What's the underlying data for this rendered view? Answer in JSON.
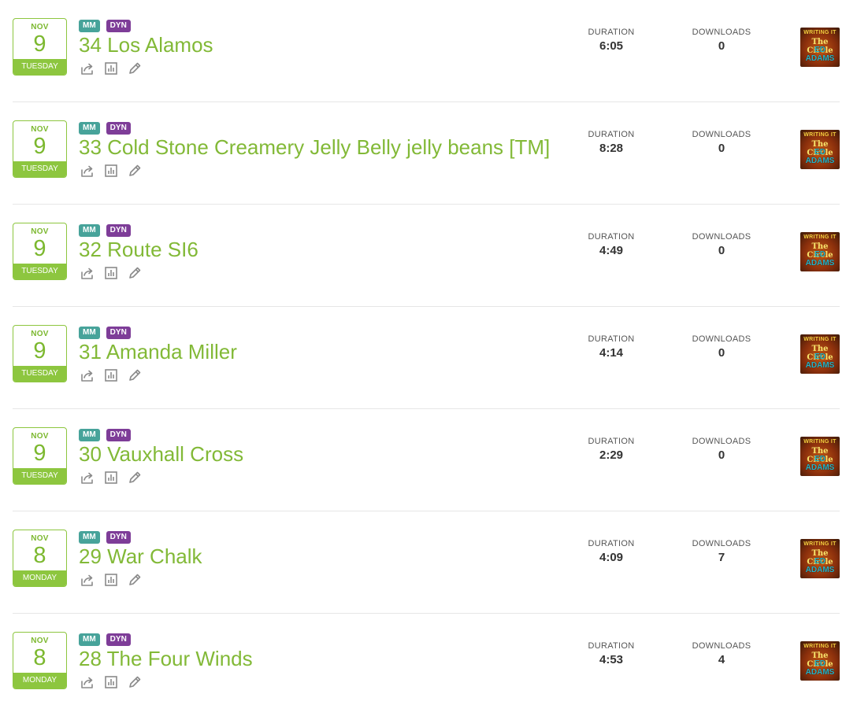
{
  "colors": {
    "accent_green": "#82b937",
    "date_border": "#8dc63f",
    "badge_mm": "#47a39a",
    "badge_dyn": "#7e3d98",
    "icon_gray": "#8a8a8a"
  },
  "labels": {
    "duration": "DURATION",
    "downloads": "DOWNLOADS"
  },
  "badges": {
    "mm": "MM",
    "dyn": "DYN"
  },
  "artwork": {
    "line1": "WRITING IT",
    "line2": "The Circle",
    "line3": "ED ADAMS"
  },
  "icons": {
    "share": "share-icon",
    "stats": "stats-icon",
    "edit": "edit-icon"
  },
  "episodes": [
    {
      "month": "NOV",
      "day": "9",
      "weekday": "TUESDAY",
      "title": "34 Los Alamos",
      "duration": "6:05",
      "downloads": "0"
    },
    {
      "month": "NOV",
      "day": "9",
      "weekday": "TUESDAY",
      "title": "33 Cold Stone Creamery Jelly Belly jelly beans [TM]",
      "duration": "8:28",
      "downloads": "0"
    },
    {
      "month": "NOV",
      "day": "9",
      "weekday": "TUESDAY",
      "title": "32 Route SI6",
      "duration": "4:49",
      "downloads": "0"
    },
    {
      "month": "NOV",
      "day": "9",
      "weekday": "TUESDAY",
      "title": "31 Amanda Miller",
      "duration": "4:14",
      "downloads": "0"
    },
    {
      "month": "NOV",
      "day": "9",
      "weekday": "TUESDAY",
      "title": "30 Vauxhall Cross",
      "duration": "2:29",
      "downloads": "0"
    },
    {
      "month": "NOV",
      "day": "8",
      "weekday": "MONDAY",
      "title": "29 War Chalk",
      "duration": "4:09",
      "downloads": "7"
    },
    {
      "month": "NOV",
      "day": "8",
      "weekday": "MONDAY",
      "title": "28 The Four Winds",
      "duration": "4:53",
      "downloads": "4"
    }
  ]
}
